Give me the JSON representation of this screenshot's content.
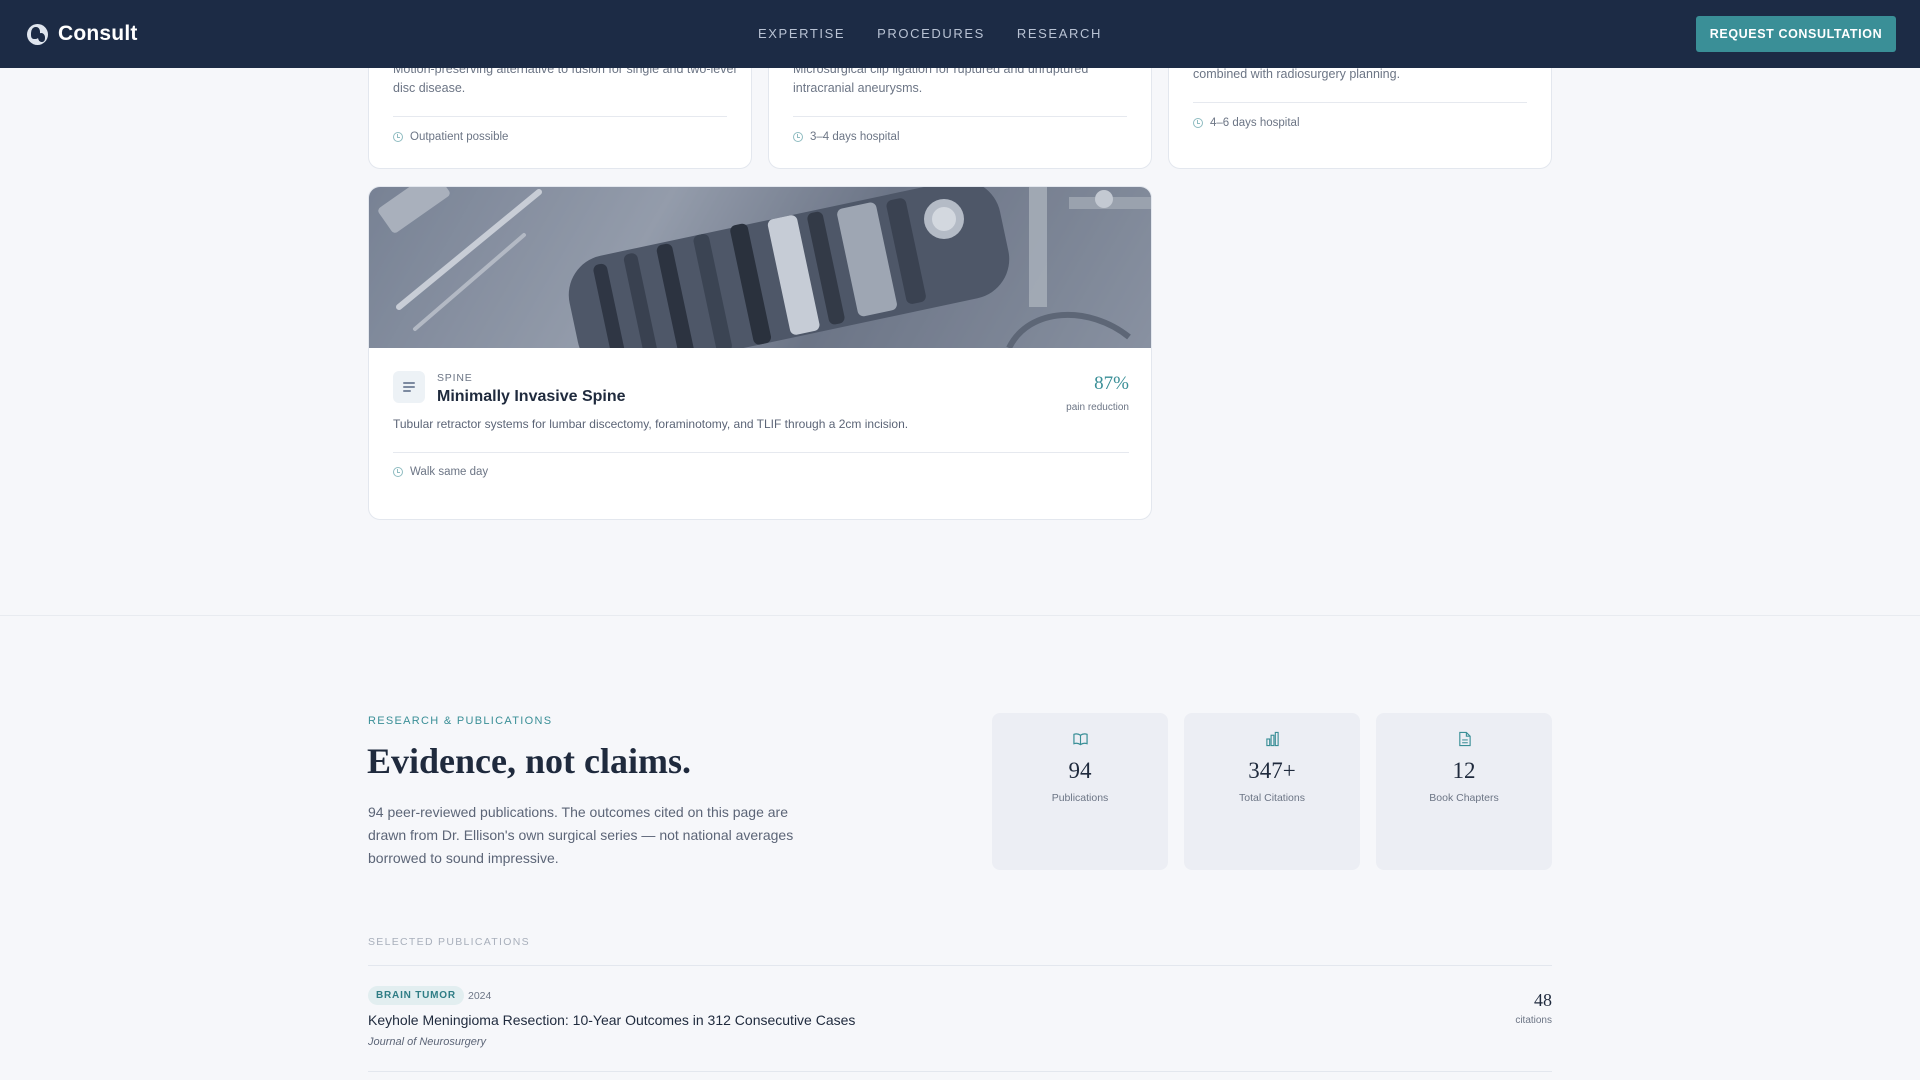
{
  "header": {
    "brand": "Consult",
    "nav": [
      "EXPERTISE",
      "PROCEDURES",
      "RESEARCH"
    ],
    "cta": "REQUEST CONSULTATION"
  },
  "colors": {
    "header_bg": "#1c2b45",
    "accent": "#3a8f97",
    "page_bg": "#f6f7fa"
  },
  "procedures": {
    "fragments": [
      {
        "desc_lines": [
          "Motion-preserving alternative to fusion for single and two-level",
          "disc disease."
        ],
        "meta": "Outpatient possible",
        "meta_icon": "clock-icon"
      },
      {
        "desc_lines": [
          "Microsurgical clip ligation for ruptured and unruptured",
          "intracranial aneurysms."
        ],
        "meta": "3–4 days hospital",
        "meta_icon": "clock-icon"
      },
      {
        "desc_lines": [
          "combined with radiosurgery planning."
        ],
        "meta": "4–6 days hospital",
        "meta_icon": "clock-icon"
      }
    ],
    "featured": {
      "category": "SPINE",
      "title": "Minimally Invasive Spine",
      "stat_value": "87%",
      "stat_label": "pain reduction",
      "description": "Tubular retractor systems for lumbar discectomy, foraminotomy, and TLIF through a 2cm incision.",
      "meta": "Walk same day",
      "icon": "document-lines-icon"
    }
  },
  "research": {
    "kicker": "RESEARCH & PUBLICATIONS",
    "heading": "Evidence, not claims.",
    "lede": "94 peer-reviewed publications. The outcomes cited on this page are drawn from Dr. Ellison's own surgical series — not national averages borrowed to sound impressive.",
    "stats": [
      {
        "value": "94",
        "label": "Publications",
        "icon": "book-icon"
      },
      {
        "value": "347+",
        "label": "Total Citations",
        "icon": "bar-chart-icon"
      },
      {
        "value": "12",
        "label": "Book Chapters",
        "icon": "file-icon"
      }
    ],
    "publications_label": "SELECTED PUBLICATIONS",
    "publications": [
      {
        "tag": "BRAIN TUMOR",
        "year": "2024",
        "title": "Keyhole Meningioma Resection: 10-Year Outcomes in 312 Consecutive Cases",
        "journal": "Journal of Neurosurgery",
        "citations": "48",
        "citations_label": "citations"
      }
    ]
  }
}
